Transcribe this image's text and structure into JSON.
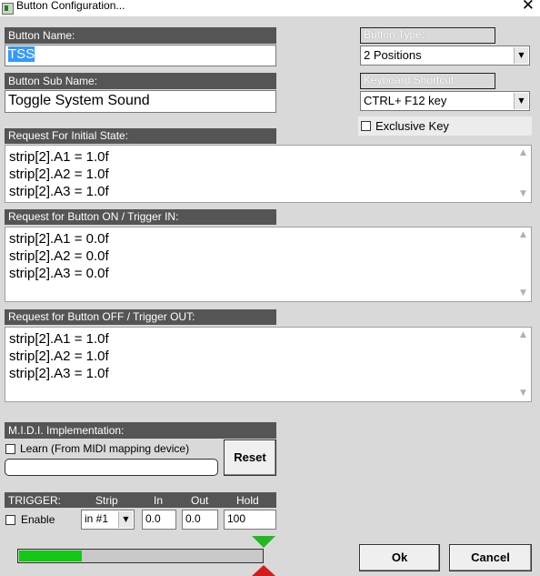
{
  "window": {
    "title": "Button Configuration...",
    "close_glyph": "✕"
  },
  "button_name": {
    "label": "Button Name:",
    "value": "TSS"
  },
  "button_sub_name": {
    "label": "Button Sub Name:",
    "value": "Toggle System Sound"
  },
  "button_type": {
    "label": "Button Type:",
    "selected": "2 Positions"
  },
  "keyboard_shortcut": {
    "label": "Keyboard Shortcut:",
    "selected": "CTRL+ F12 key",
    "exclusive_label": "Exclusive Key",
    "exclusive_checked": false
  },
  "initial_state": {
    "label": "Request For Initial State:",
    "lines": [
      "strip[2].A1 = 1.0f",
      "strip[2].A2 = 1.0f",
      "strip[2].A3 = 1.0f"
    ]
  },
  "button_on": {
    "label": "Request for Button ON / Trigger IN:",
    "lines": [
      "strip[2].A1 = 0.0f",
      "strip[2].A2 = 0.0f",
      "strip[2].A3 = 0.0f"
    ]
  },
  "button_off": {
    "label": "Request for Button OFF / Trigger OUT:",
    "lines": [
      "strip[2].A1 = 1.0f",
      "strip[2].A2 = 1.0f",
      "strip[2].A3 = 1.0f"
    ]
  },
  "midi": {
    "label": "M.I.D.I. Implementation:",
    "learn_label": "Learn (From MIDI mapping device)",
    "learn_checked": false,
    "reset_label": "Reset"
  },
  "trigger": {
    "label": "TRIGGER:",
    "col_strip": "Strip",
    "col_in": "In",
    "col_out": "Out",
    "col_hold": "Hold",
    "enable_label": "Enable",
    "enable_checked": false,
    "strip_value": "in #1",
    "in_value": "0.0",
    "out_value": "0.0",
    "hold_value": "100",
    "level_fraction": 0.26
  },
  "actions": {
    "ok_label": "Ok",
    "cancel_label": "Cancel"
  },
  "icons": {
    "scroll_up": "▲",
    "scroll_down": "▼",
    "dropdown": "▼"
  },
  "colors": {
    "label_bar": "#555555",
    "meter_fill": "#14c814",
    "marker_in": "#22b822",
    "marker_out": "#d41c1c",
    "selection": "#3399ff"
  }
}
